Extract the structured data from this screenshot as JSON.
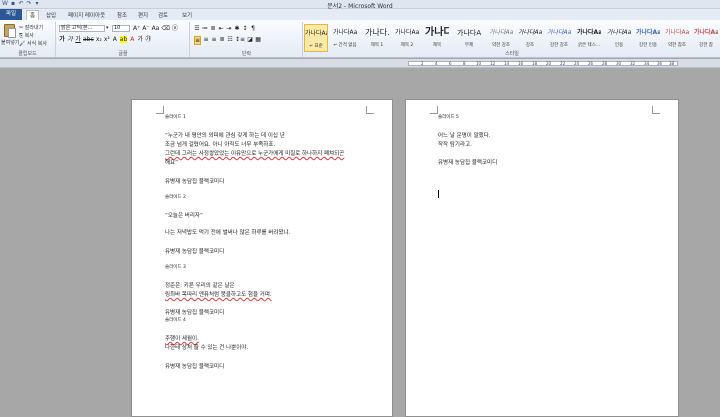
{
  "window": {
    "title": "문서2 - Microsoft Word"
  },
  "tabs": [
    "파일",
    "홈",
    "삽입",
    "페이지 레이아웃",
    "참조",
    "편지",
    "검토",
    "보기"
  ],
  "clipboard": {
    "paste": "붙여넣기",
    "cut": "잘라내기",
    "copy": "복사",
    "format_painter": "서식 복사",
    "label": "클립보드"
  },
  "font": {
    "name": "맑은 고딕(본...",
    "size": "10",
    "label": "글꼴"
  },
  "paragraph": {
    "label": "단락"
  },
  "styles": {
    "label": "스타일",
    "items": [
      {
        "sample": "가나다AaI",
        "name": "↵ 표준"
      },
      {
        "sample": "가나다AaI",
        "name": "↵ 간격 없음"
      },
      {
        "sample": "가나다.",
        "name": "제목 1"
      },
      {
        "sample": "가나다AaI",
        "name": "제목 2"
      },
      {
        "sample": "가나디",
        "name": "제목"
      },
      {
        "sample": "가나다A",
        "name": "부제"
      },
      {
        "sample": "가나다AaI",
        "name": "약한 강조"
      },
      {
        "sample": "가나다Aa",
        "name": "강조"
      },
      {
        "sample": "가나다AaI",
        "name": "강한 강조"
      },
      {
        "sample": "가나다AaI",
        "name": "굵은 텍스..."
      },
      {
        "sample": "가나다AaI",
        "name": "인용"
      },
      {
        "sample": "가나다AaI",
        "name": "강한 인용"
      },
      {
        "sample": "가나다AaI",
        "name": "약한 참조"
      },
      {
        "sample": "가나다AaI",
        "name": "강한 참"
      }
    ]
  },
  "ruler": {
    "numbers": [
      "2",
      "4",
      "6",
      "8",
      "10",
      "12",
      "14",
      "16",
      "18",
      "20",
      "22",
      "24",
      "26",
      "28",
      "30",
      "32",
      "34",
      "36",
      "38"
    ]
  },
  "page1": {
    "lines": [
      "슬라이드 1",
      "“누군가 내 평안의 외피에 관심 갖게 하는 데 이십 년",
      "조금 넘게 걸렸어요. 아니 아직도 너무 부족하죠.",
      "그런데 그러는 사정쌓았었는 이유만으로 누군가에게 미칠로 하나하지 폐쳐되곤",
      "해요”",
      "유병재 농담집 블랙코미디",
      "슬라이드 2",
      "“오늘은 버리자”",
      "나는 저녁밥도 먹기 전에 벌써나 많은 하루를 버려왔냐.",
      "유병재 농담집 블랙코미디",
      "슬라이드 3",
      "정준은: 키른 우리의 같은 날은",
      "링최바 목따리 엔퓨처럼 뭉클하고도 험을 거며.",
      "유병재 농담집 블랙코미디",
      "슬라이드 4",
      "주행이 세월이.",
      "나한테 상처 줄 수 있는 건 나뿐이야.",
      "유병재 농담집 블랙코미디"
    ]
  },
  "page2": {
    "lines": [
      "슬라이드 5",
      "어느 날 운명이 말했다.",
      "작작 탐기라고.",
      "유병재 농담집 블랙코미디"
    ]
  }
}
